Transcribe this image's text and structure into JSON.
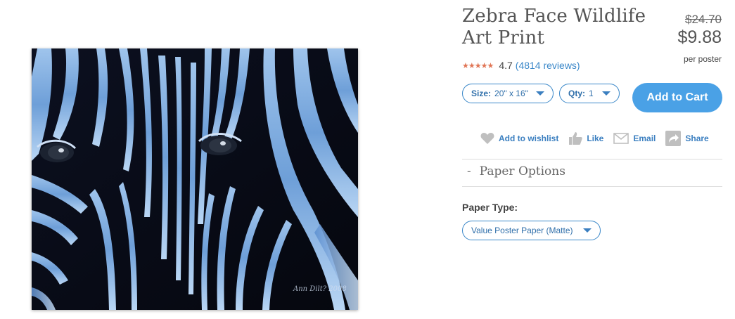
{
  "product": {
    "title": "Zebra Face Wildlife Art Print",
    "original_price": "$24.70",
    "price": "$9.88",
    "price_unit": "per poster",
    "rating_stars": "★★★★★",
    "rating_value": "4.7",
    "reviews_text": "(4814 reviews)",
    "image_signature": "Ann Dilt? 2008",
    "image_description_icon": "zebra-artwork"
  },
  "options": {
    "size_label": "Size:",
    "size_value": "20\" x 16\"",
    "qty_label": "Qty:",
    "qty_value": "1",
    "add_to_cart": "Add to Cart"
  },
  "actions": {
    "wishlist": "Add to wishlist",
    "like": "Like",
    "email": "Email",
    "share": "Share"
  },
  "paper_options": {
    "toggle": "-",
    "header": "Paper Options",
    "type_label": "Paper Type:",
    "type_value": "Value Poster Paper (Matte)"
  },
  "colors": {
    "accent": "#4aa1e6",
    "link": "#3b88c9",
    "stars": "#e07555"
  }
}
